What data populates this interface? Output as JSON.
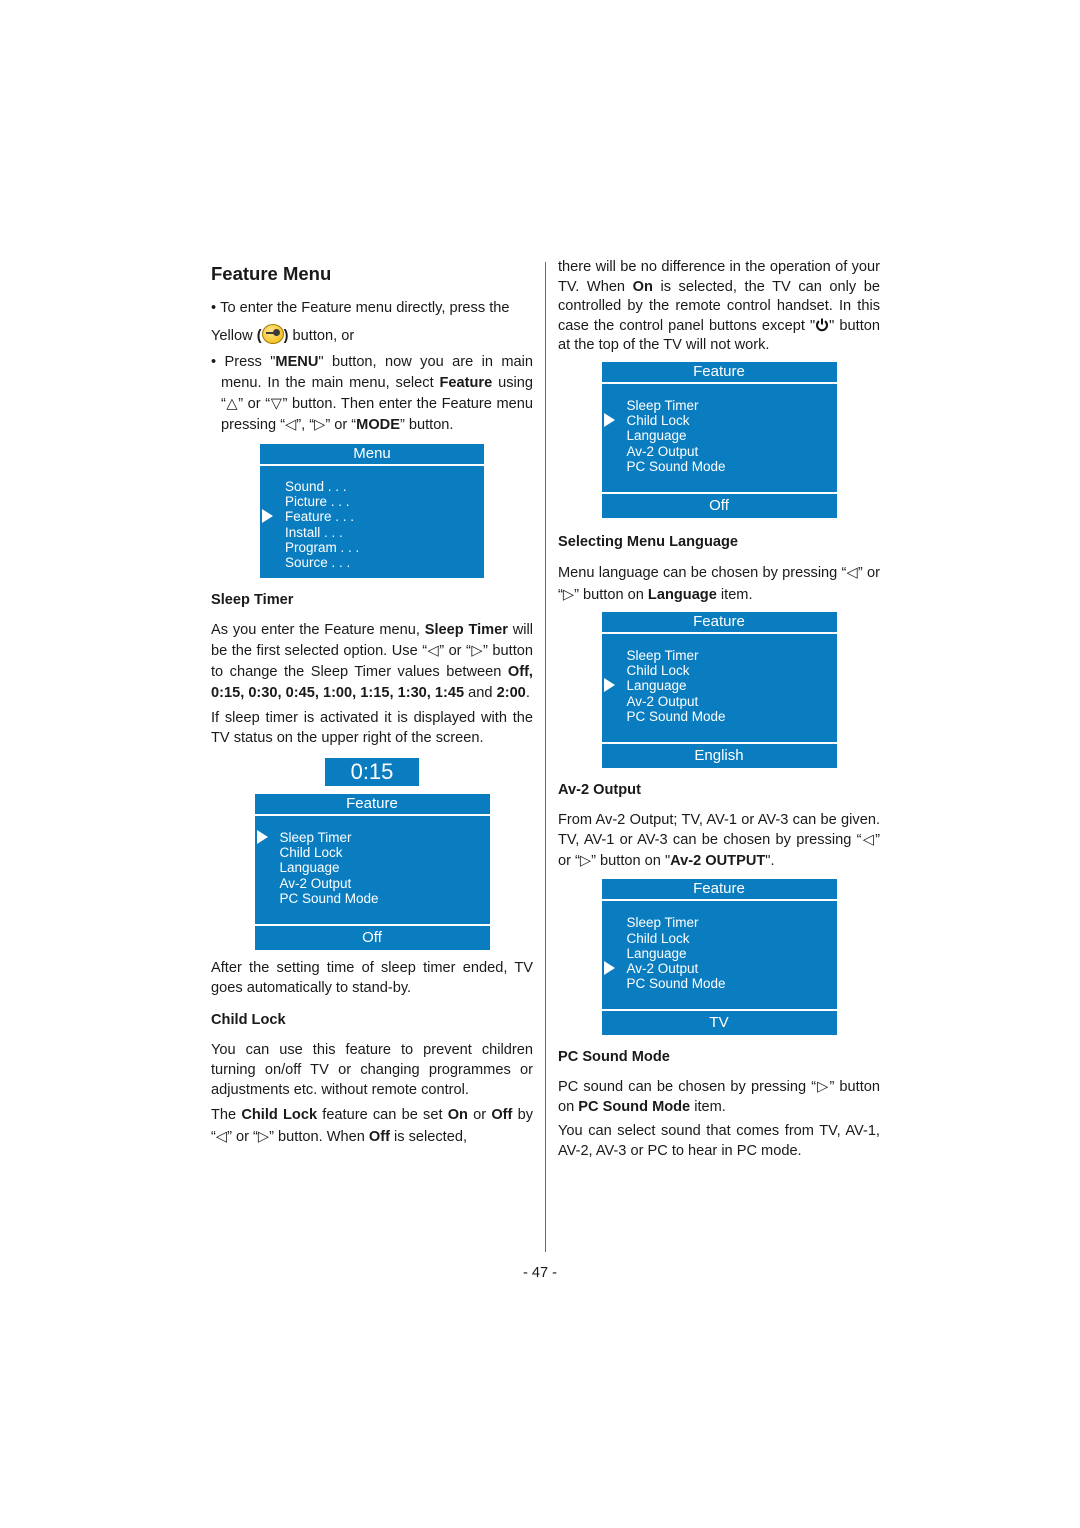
{
  "page_number": "- 47 -",
  "title": "Feature Menu",
  "intro": {
    "bullet1_a": "To enter the Feature menu directly, press the",
    "bullet1_yellow": "Yellow",
    "bullet1_b": "button, or",
    "bullet2_a": "Press \"",
    "bullet2_menu": "MENU",
    "bullet2_b": "\" button, now you are in main menu. In the main menu, select ",
    "bullet2_feature": "Feature",
    "bullet2_c": " using “△” or “▽” button. Then enter the Feature menu pressing “◁”, “▷” or “",
    "bullet2_mode": "MODE",
    "bullet2_d": "” button.",
    "yellow_button_icon": "key-icon"
  },
  "main_menu": {
    "title": "Menu",
    "items": [
      "Sound . . .",
      "Picture . . .",
      "Feature . . .",
      "Install . . .",
      "Program . . .",
      "Source . . ."
    ],
    "selected_index": 2
  },
  "sleep_timer": {
    "heading": "Sleep Timer",
    "p1_a": "As you enter the Feature menu, ",
    "p1_b": "Sleep Timer",
    "p1_c": " will be the first selected option. Use “◁” or “▷” button to change the Sleep Timer values between ",
    "p1_values": "Off, 0:15, 0:30, 0:45, 1:00, 1:15, 1:30, 1:45",
    "p1_and": " and ",
    "p1_last": "2:00",
    "p1_end": ".",
    "p2": "If sleep timer is activated it is displayed with the TV status on the upper right of the screen.",
    "timer_display": "0:15",
    "p3": "After the setting time of sleep timer ended, TV goes automatically to stand-by."
  },
  "feature_menu_items": [
    "Sleep Timer",
    "Child Lock",
    "Language",
    "Av-2 Output",
    "PC Sound Mode"
  ],
  "feature_menu_title": "Feature",
  "osd_examples": [
    {
      "selected_index": 0,
      "value": "Off"
    },
    {
      "selected_index": 1,
      "value": "Off"
    },
    {
      "selected_index": 2,
      "value": "English"
    },
    {
      "selected_index": 3,
      "value": "TV"
    }
  ],
  "child_lock": {
    "heading": "Child Lock",
    "p1": "You can use this feature to prevent children turning on/off TV or changing programmes or adjustments etc. without remote control.",
    "p2_a": "The ",
    "p2_b": "Child Lock",
    "p2_c": " feature can be set ",
    "p2_on": "On",
    "p2_or": " or ",
    "p2_off": "Off",
    "p2_d": " by “◁” or “▷” button. When ",
    "p2_off2": "Off",
    "p2_e": " is selected, there will be no difference in the operation of your TV. When ",
    "p2_on2": "On",
    "p2_f": " is selected, the TV can only be controlled by the remote control handset. In this case the control panel buttons except \"",
    "p2_g": "\" button at the top of the TV will not work.",
    "power_icon": "power-icon"
  },
  "language": {
    "heading": "Selecting Menu Language",
    "p1_a": "Menu language can be chosen by pressing “◁” or “▷” button on ",
    "p1_b": "Language",
    "p1_c": " item."
  },
  "av2": {
    "heading": "Av-2 Output",
    "p1_a": "From Av-2 Output; TV, AV-1 or AV-3 can be given. TV, AV-1 or AV-3 can be chosen by pressing “◁” or “▷” button on \"",
    "p1_b": "Av-2 OUTPUT",
    "p1_c": "\"."
  },
  "pc_sound": {
    "heading": "PC Sound Mode",
    "p1_a": "PC sound can be chosen by pressing “▷” button on ",
    "p1_b": "PC Sound Mode",
    "p1_c": " item.",
    "p2": "You can select sound that comes from TV, AV-1, AV-2, AV-3 or PC to hear in PC mode."
  },
  "colors": {
    "osd_blue": "#0a7dc1",
    "yellow_button": "#f2b400"
  }
}
